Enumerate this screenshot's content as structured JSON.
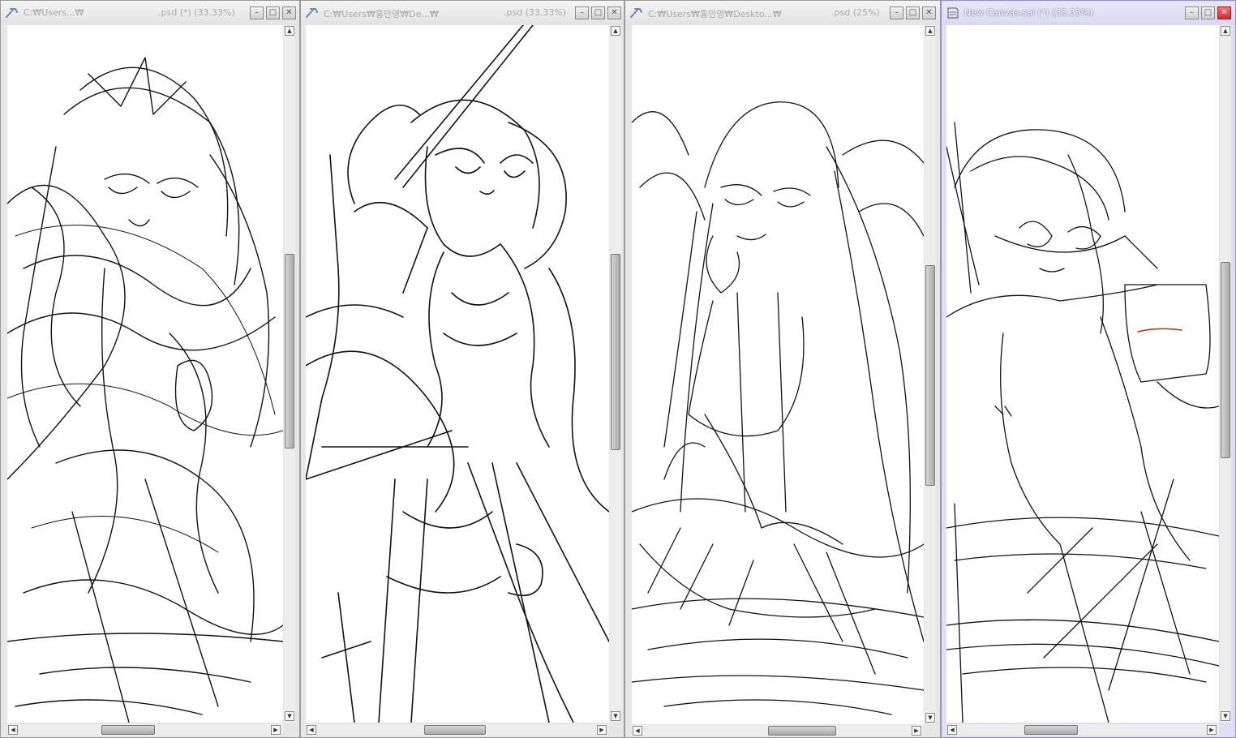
{
  "windows": [
    {
      "title": "C:\\Users...\\    .psd (*) (33.33%)",
      "path_prefix": "C:₩Users...₩",
      "path_suffix": ".psd (*) (33.33%)",
      "active": false
    },
    {
      "title": "C:\\Users\\홍만영\\De...\\   .psd (33.33%)",
      "path_prefix": "C:₩Users₩홍만영₩De...₩",
      "path_suffix": ".psd (33.33%)",
      "active": false
    },
    {
      "title": "C:\\Users\\홍만영\\Deskto...\\   .psd (25%)",
      "path_prefix": "C:₩Users₩홍만영₩Deskto...₩",
      "path_suffix": ".psd (25%)",
      "active": false
    },
    {
      "title": "New Canvas.sai (*) (33.33%)",
      "path_prefix": "New Canvas.sai (*) (33.33%)",
      "path_suffix": "",
      "active": true
    }
  ],
  "buttons": {
    "minimize": "–",
    "maximize": "□",
    "close": "✕"
  },
  "arrows": {
    "up": "▲",
    "down": "▼",
    "left": "◀",
    "right": "▶"
  },
  "icons": {
    "app": "sai-app-icon",
    "minimize": "minimize-icon",
    "maximize": "maximize-icon",
    "close": "close-icon"
  },
  "colors": {
    "stroke": "#111111",
    "active_border": "#8c8cd8",
    "close_active": "#d42a2a"
  }
}
